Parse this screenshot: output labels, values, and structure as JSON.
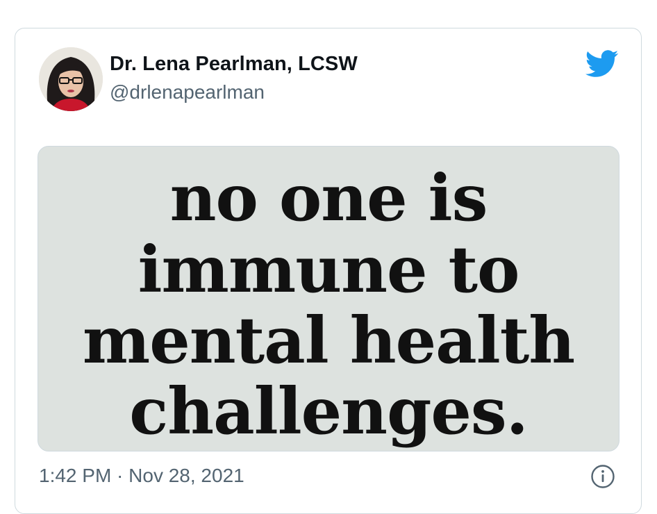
{
  "tweet": {
    "author": {
      "display_name": "Dr. Lena Pearlman, LCSW",
      "handle": "@drlenapearlman",
      "avatar_icon": "profile-photo"
    },
    "brand_icon": "twitter-bird-icon",
    "brand_color": "#1d9bf0",
    "media": {
      "background_color": "#dde2df",
      "lines": [
        "no one is",
        "immune to",
        "mental health",
        "challenges."
      ]
    },
    "timestamp": "1:42 PM · Nov 28, 2021",
    "info_icon": "info-icon"
  }
}
